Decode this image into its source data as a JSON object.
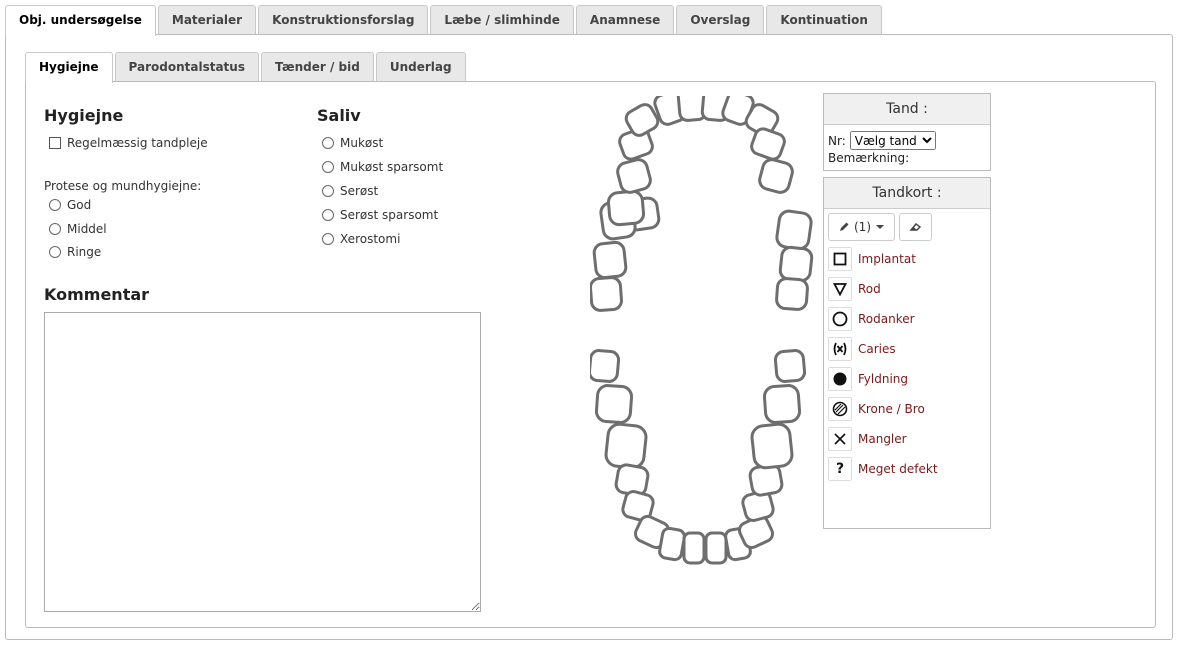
{
  "outer_tabs": [
    "Obj. undersøgelse",
    "Materialer",
    "Konstruktionsforslag",
    "Læbe / slimhinde",
    "Anamnese",
    "Overslag",
    "Kontinuation"
  ],
  "inner_tabs": [
    "Hygiejne",
    "Parodontalstatus",
    "Tænder / bid",
    "Underlag"
  ],
  "hygiejne": {
    "heading": "Hygiejne",
    "checkbox_label": "Regelmæssig tandpleje",
    "protese_label": "Protese og mundhygiejne:",
    "options": [
      "God",
      "Middel",
      "Ringe"
    ]
  },
  "saliv": {
    "heading": "Saliv",
    "options": [
      "Mukøst",
      "Mukøst sparsomt",
      "Serøst",
      "Serøst sparsomt",
      "Xerostomi"
    ]
  },
  "kommentar": {
    "heading": "Kommentar",
    "value": ""
  },
  "tand": {
    "title": "Tand :",
    "nr_label": "Nr:",
    "select_value": "Vælg tand",
    "remark_label": "Bemærkning:"
  },
  "tandkort": {
    "title": "Tandkort :",
    "pen_label": "(1)",
    "symbols": [
      {
        "icon": "square-icon",
        "label": "Implantat"
      },
      {
        "icon": "triangle-down-icon",
        "label": "Rod"
      },
      {
        "icon": "circle-outline-icon",
        "label": "Rodanker"
      },
      {
        "icon": "caries-icon",
        "label": "Caries"
      },
      {
        "icon": "filled-circle-icon",
        "label": "Fyldning"
      },
      {
        "icon": "hatched-circle-icon",
        "label": "Krone / Bro"
      },
      {
        "icon": "cross-icon",
        "label": "Mangler"
      },
      {
        "icon": "question-icon",
        "label": "Meget defekt"
      }
    ],
    "label_color": "#7a1a1a"
  }
}
